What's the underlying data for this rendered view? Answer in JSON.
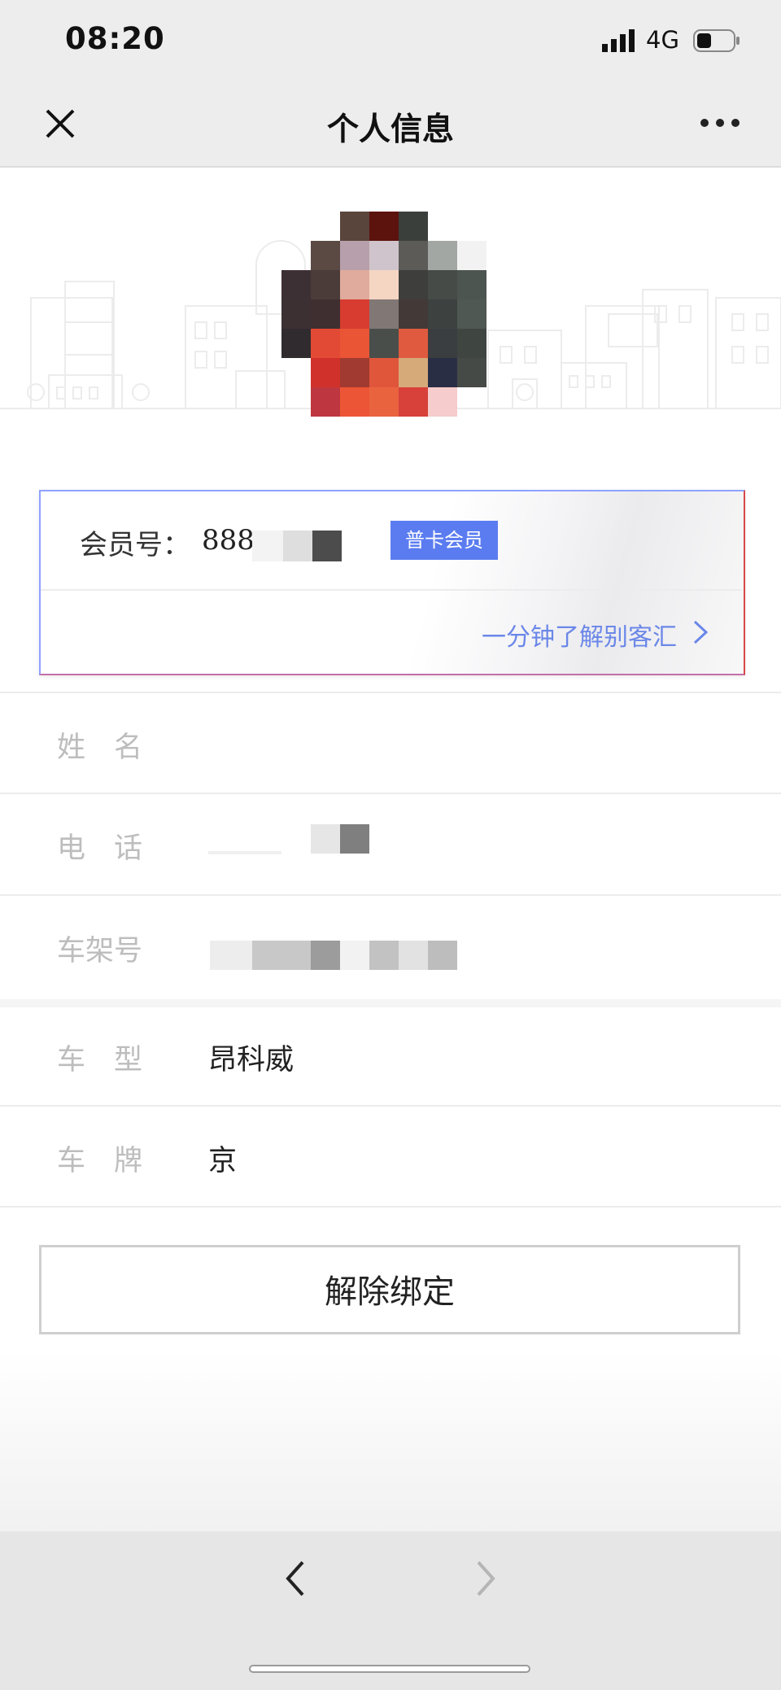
{
  "status_bar": {
    "time": "08:20",
    "network": "4G",
    "battery_fill": 0.35
  },
  "nav": {
    "title": "个人信息",
    "close_icon": "close-icon",
    "more_icon": "more-icon"
  },
  "member_card": {
    "member_label": "会员号：",
    "member_number_visible": "888",
    "badge": "普卡会员",
    "learn_more": "一分钟了解别客汇",
    "accent_color": "#5b7cf0",
    "link_color": "#6b87e8"
  },
  "fields": {
    "name_label": "姓　名",
    "name_value": "",
    "phone_label": "电　话",
    "vin_label": "车架号",
    "model_label": "车　型",
    "model_value": "昂科威",
    "plate_label": "车　牌",
    "plate_value": "京"
  },
  "actions": {
    "unbind_label": "解除绑定"
  },
  "bottom_nav": {
    "back_icon": "chevron-left-icon",
    "forward_icon": "chevron-right-icon"
  }
}
